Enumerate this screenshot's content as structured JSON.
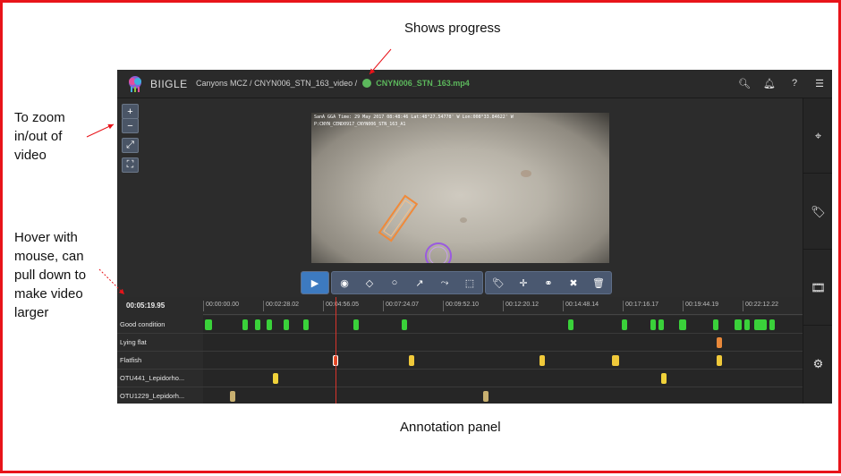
{
  "callouts": {
    "top": "Shows progress",
    "zoom": "To zoom in/out of video",
    "hover": "Hover with mouse, can pull down to make video larger",
    "panel": "Annotation panel"
  },
  "navbar": {
    "brand": "BIIGLE",
    "breadcrumb_project": "Canyons MCZ",
    "breadcrumb_volume": "CNYN006_STN_163_video",
    "separator": "/",
    "file": "CNYN006_STN_163.mp4",
    "icons": [
      "search-icon",
      "bell-icon",
      "help-icon",
      "menu-icon"
    ]
  },
  "video_overlay": {
    "line1": "SanA  GGA Time: 29 May 2017 08:48:46 Lat:48°27.54778' W  Lon:008°33.84622' W",
    "line2": "P:CNYN_CEND0917_CNYN006_STN_163_A1"
  },
  "zoom_controls": {
    "zoom_in": "+",
    "zoom_out": "−"
  },
  "toolbar": {
    "tools": [
      "play-icon",
      "point-icon",
      "rectangle-icon",
      "circle-icon",
      "linestring-icon",
      "polygon-icon",
      "selection-icon",
      "tag-icon",
      "move-icon",
      "link-icon",
      "unlink-icon",
      "delete-icon"
    ]
  },
  "sidebar": {
    "icons": [
      "map-marker-icon",
      "tags-icon",
      "film-icon",
      "settings-icon"
    ]
  },
  "timeline": {
    "current_time": "00:05:19.95",
    "ticks": [
      "00:00:00.00",
      "00:02:28.02",
      "00:04:56.05",
      "00:07:24.07",
      "00:09:52.10",
      "00:12:20.12",
      "00:14:48.14",
      "00:17:16.17",
      "00:19:44.19",
      "00:22:12.22"
    ],
    "labels": [
      "Good condition",
      "Lying flat",
      "Flatfish",
      "OTU441_Lepidorho...",
      "OTU1229_Lepidorh..."
    ],
    "colors": {
      "good": "#3ad13a",
      "lying": "#e8883a",
      "flatfish": "#f0c93a",
      "flatfish_active": "#e8552a",
      "otu441": "#f0d23a",
      "otu1229": "#c8b070"
    }
  }
}
